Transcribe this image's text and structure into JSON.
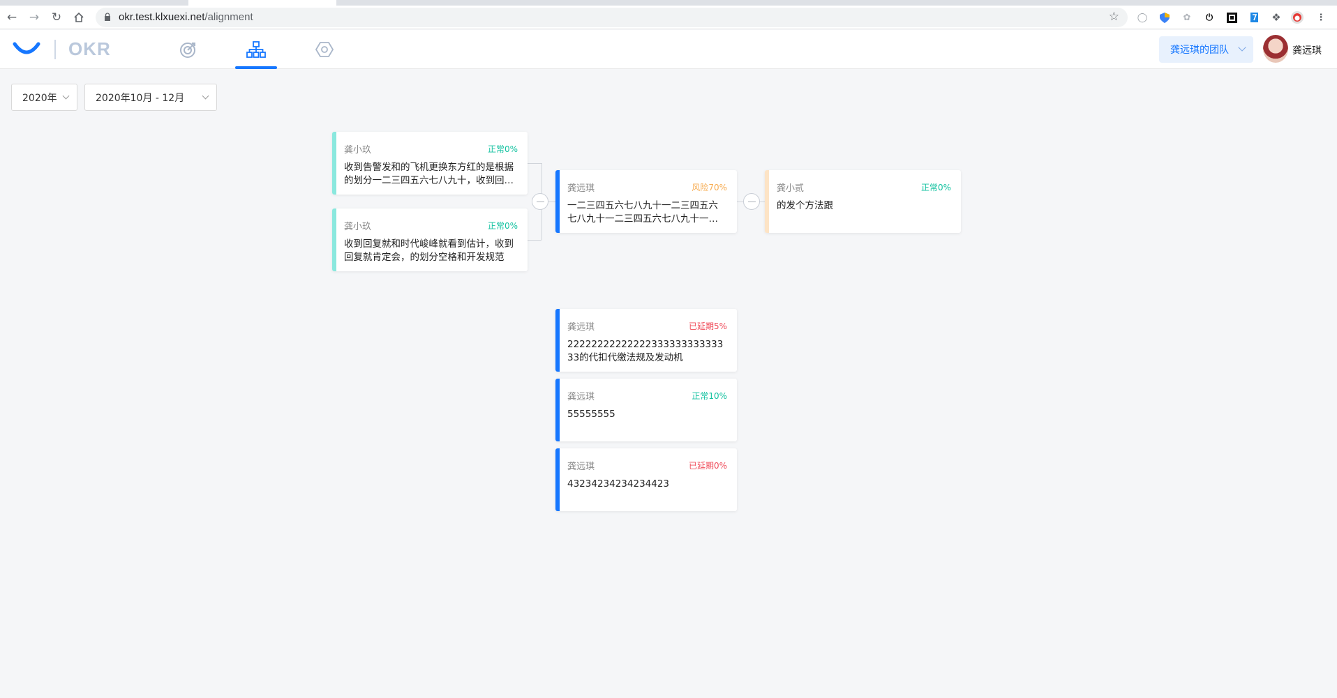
{
  "browser": {
    "url_host": "okr.test.klxuexi.net",
    "url_path": "/alignment"
  },
  "header": {
    "logo_text": "OKR",
    "team_select": "龚远琪的团队",
    "user_name": "龚远琪"
  },
  "filters": {
    "year": "2020年",
    "period": "2020年10月 - 12月"
  },
  "colors": {
    "blue": "#1677ff",
    "cyan_bar": "#8ae8de",
    "peach_bar": "#fde4c6",
    "green": "#13c2a0",
    "orange": "#f7ac52",
    "red": "#f04e5c"
  },
  "cards": {
    "left1": {
      "owner": "龚小玖",
      "status": "正常0%",
      "text": "收到告警发和的飞机更换东方红的是根据的划分一二三四五六七八九十，收到回复就肯定会"
    },
    "left2": {
      "owner": "龚小玖",
      "status": "正常0%",
      "text": "收到回复就和时代峻峰就看到估计，收到回复就肯定会，的划分空格和开发规范"
    },
    "center": {
      "owner": "龚远琪",
      "status": "风险70%",
      "text": "一二三四五六七八九十一二三四五六七八九十一二三四五六七八九十一二三四五六"
    },
    "right": {
      "owner": "龚小贰",
      "status": "正常0%",
      "text": "的发个方法跟"
    },
    "list1": {
      "owner": "龚远琪",
      "status": "已延期5%",
      "text": "2222222222222233333333333333的代扣代缴法规及发动机"
    },
    "list2": {
      "owner": "龚远琪",
      "status": "正常10%",
      "text": "55555555"
    },
    "list3": {
      "owner": "龚远琪",
      "status": "已延期0%",
      "text": "43234234234234423"
    }
  }
}
